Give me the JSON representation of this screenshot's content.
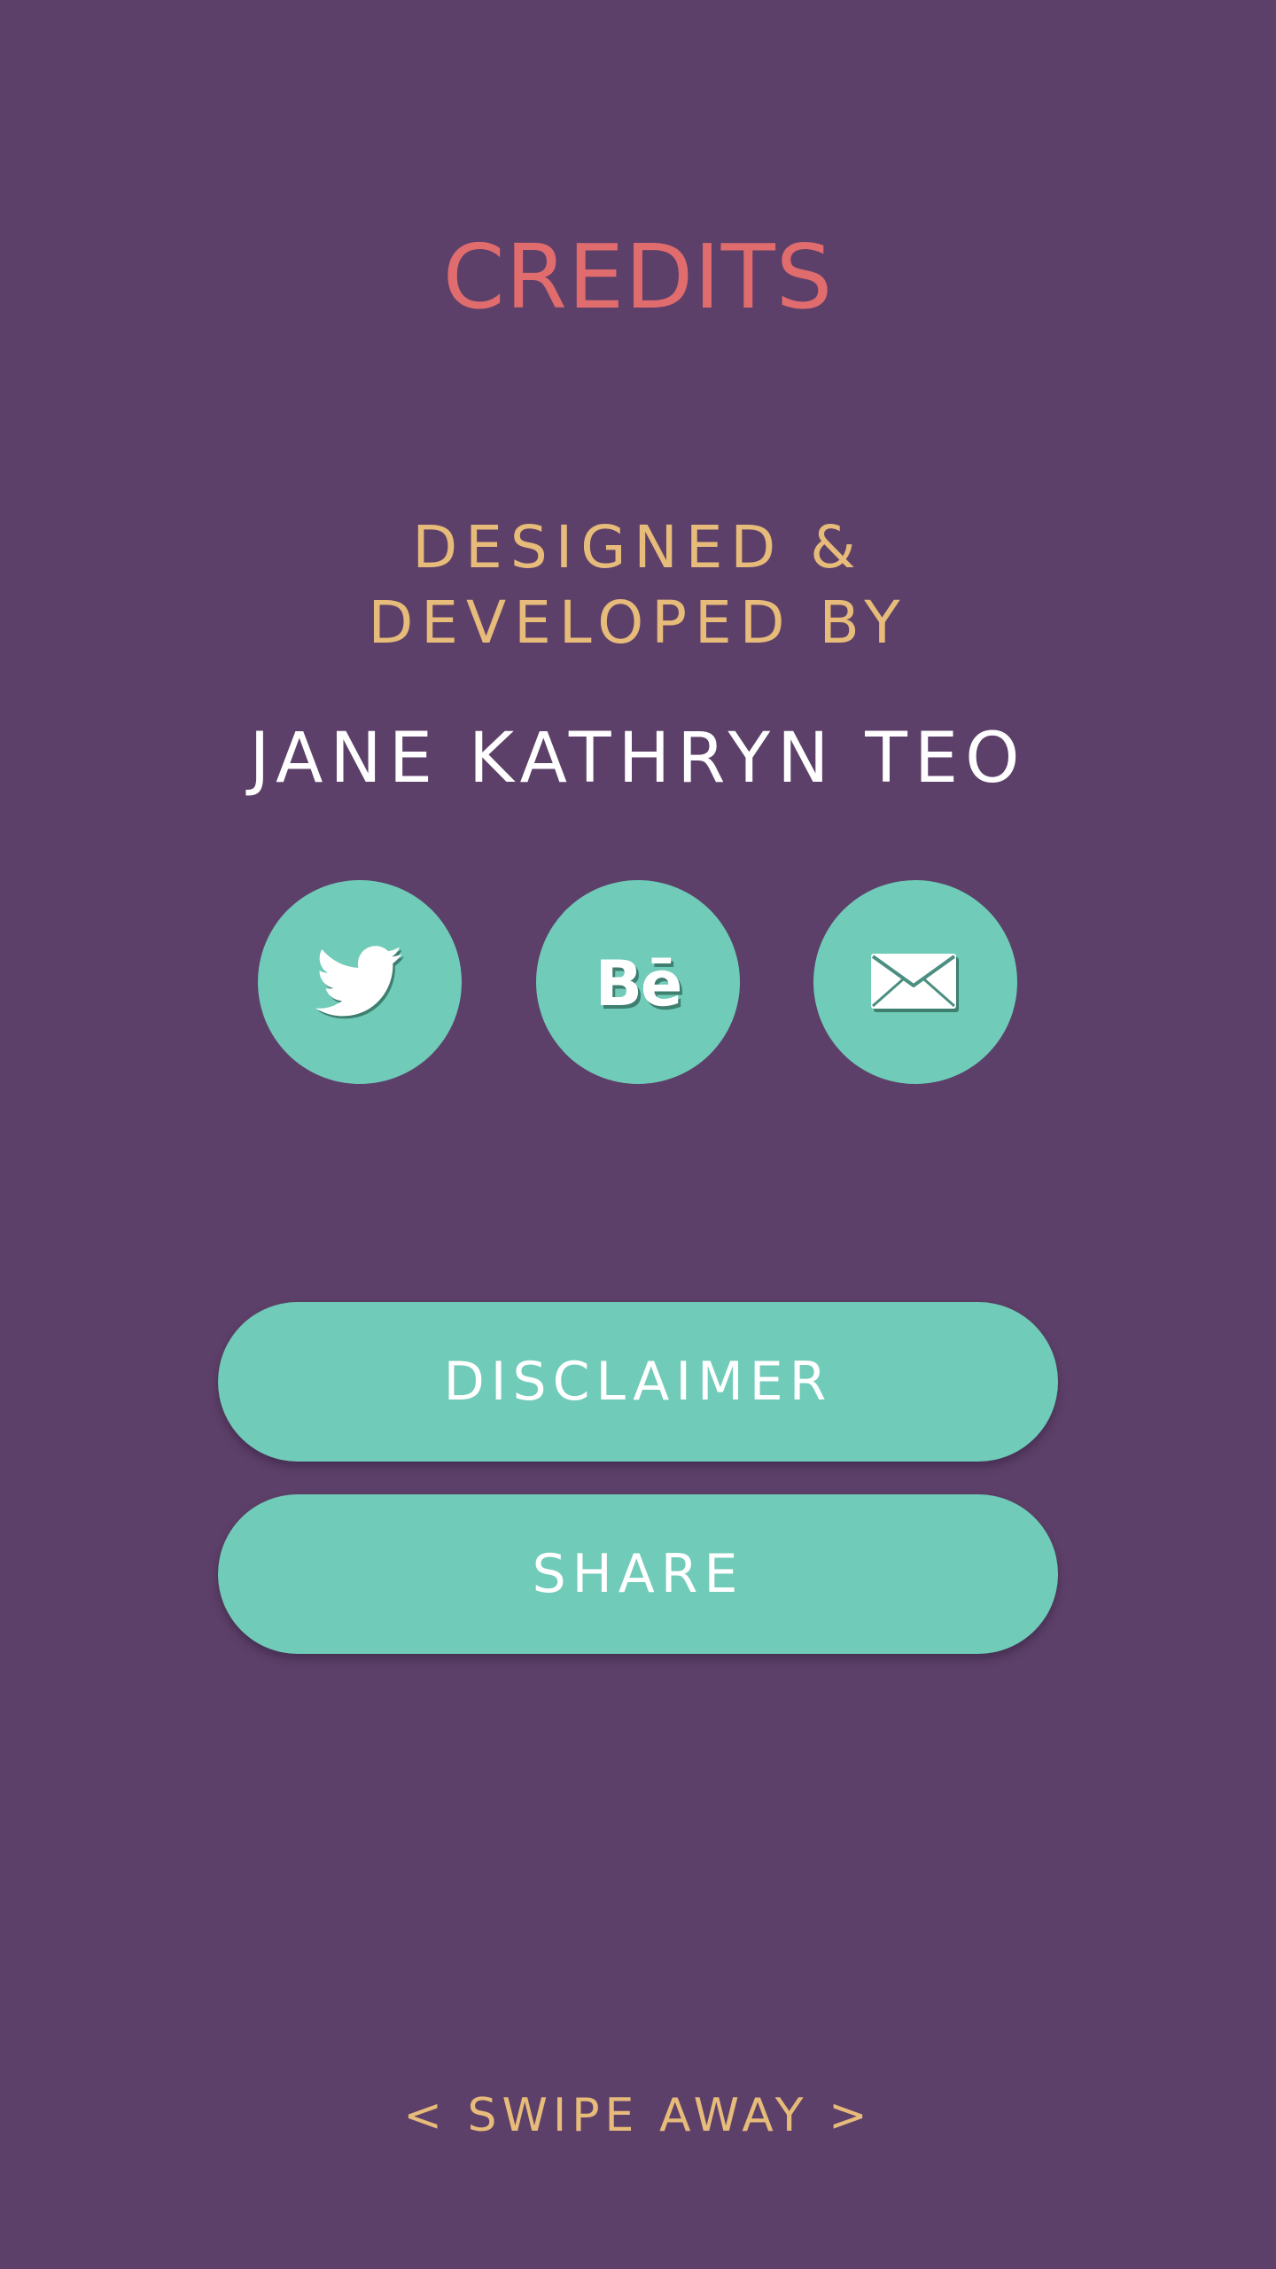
{
  "screen": {
    "title": "CREDITS",
    "subtitle_line1": "DESIGNED &",
    "subtitle_line2": "DEVELOPED BY",
    "author": "JANE KATHRYN TEO"
  },
  "social": [
    {
      "name": "twitter",
      "icon": "twitter-bird-icon"
    },
    {
      "name": "behance",
      "icon": "behance-icon",
      "glyph": "Bē"
    },
    {
      "name": "email",
      "icon": "envelope-icon"
    }
  ],
  "buttons": {
    "disclaimer_label": "DISCLAIMER",
    "share_label": "SHARE"
  },
  "footer": {
    "swipe_hint": "< SWIPE AWAY >"
  },
  "colors": {
    "background": "#5d4069",
    "title": "#e06c6e",
    "accent_gold": "#e7bb7a",
    "teal": "#70cbb8",
    "text_white": "#ffffff"
  }
}
